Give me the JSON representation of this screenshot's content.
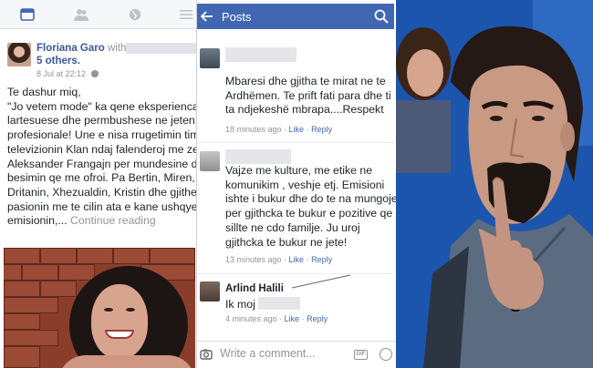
{
  "left_panel": {
    "post": {
      "author": "Floriana Garo",
      "with_word": "with",
      "others": "5 others.",
      "time": "8 Jul at 22:12",
      "body": "Te dashur miq,\n\"Jo vetem mode\" ka qene eksperienca me lartesuese dhe permbushese ne jeten time profesionale! Une e nisa rrugetimin tim ne televizionin Klan ndaj falenderoj me zemer Aleksander Frangajn per mundesine dhe besimin qe me ofroi. Pa Bertin, Miren, Dritanin, Xhezualdin, Kristin dhe gjithe pasionin me te cilin ata e kane ushqyer emisionin,...",
      "continue": "Continue reading"
    }
  },
  "middle_panel": {
    "header_title": "Posts",
    "comments": [
      {
        "text": "Mbaresi dhe gjitha te mirat ne te Ardhëmen. Te prift fati para dhe ti  ta ndjekeshë mbrapa....Respekt",
        "time": "18 minutes ago",
        "like": "Like",
        "reply": "Reply"
      },
      {
        "text": "Vajze me kulture, me etike ne komunikim , veshje etj. Emisioni ishte i bukur dhe do te na mungoje per gjithcka te bukur e pozitive qe sillte ne cdo familje. Ju uroj gjithcka te bukur ne jete!",
        "time": "13 minutes ago",
        "like": "Like",
        "reply": "Reply"
      },
      {
        "name": "Arlind Halili",
        "text": "Ik moj",
        "time": "4 minutes ago",
        "like": "Like",
        "reply": "Reply"
      }
    ],
    "composer": {
      "placeholder": "Write a comment...",
      "gif_label": "GIF"
    }
  },
  "colors": {
    "facebook_blue": "#4267b2",
    "link_blue": "#3b5998",
    "meta_gray": "#90949c"
  }
}
